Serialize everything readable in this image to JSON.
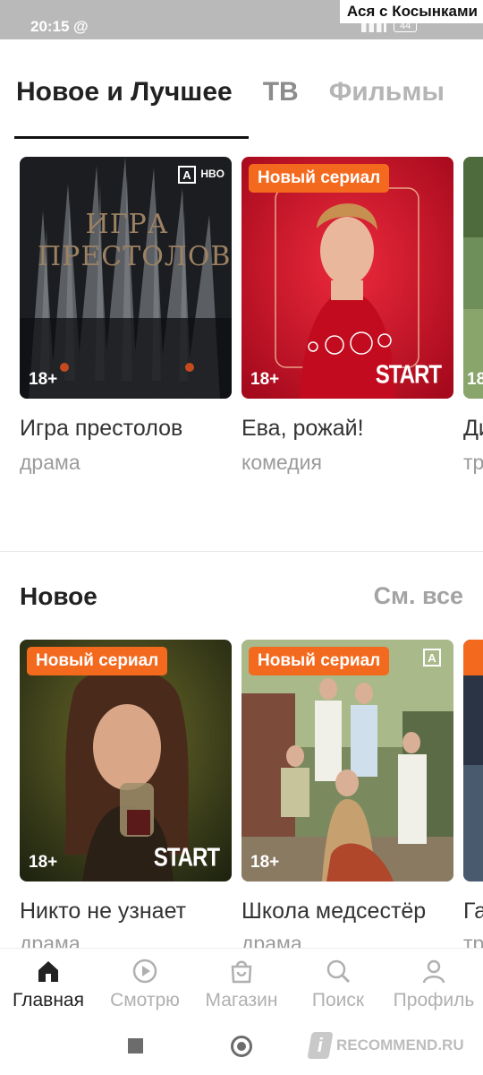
{
  "status_bar": {
    "time": "20:15",
    "at_icon": "@",
    "battery": "44"
  },
  "watermark": "Ася с Косынками",
  "tabs": [
    {
      "label": "Новое и Лучшее",
      "active": true
    },
    {
      "label": "ТВ",
      "active": false
    },
    {
      "label": "Фильмы",
      "active": false
    }
  ],
  "row1": [
    {
      "title": "Игра престолов",
      "genre": "драма",
      "age": "18+",
      "poster_text": "ИГРА ПРЕСТОЛОВ",
      "brand": "HBO"
    },
    {
      "title": "Ева, рожай!",
      "genre": "комедия",
      "age": "18+",
      "badge": "Новый сериал",
      "start": "START"
    },
    {
      "title": "Ди",
      "genre": "тр",
      "age": "18"
    }
  ],
  "section": {
    "title": "Новое",
    "see_all": "См. все"
  },
  "row2": [
    {
      "title": "Никто не узнает",
      "genre": "драма",
      "age": "18+",
      "badge": "Новый сериал",
      "start": "START"
    },
    {
      "title": "Школа медсестёр",
      "genre": "драма",
      "age": "18+",
      "badge": "Новый сериал"
    },
    {
      "title": "Га",
      "genre": "тр"
    }
  ],
  "bottom_nav": [
    {
      "label": "Главная",
      "icon": "home-icon",
      "active": true
    },
    {
      "label": "Смотрю",
      "icon": "play-circle-icon",
      "active": false
    },
    {
      "label": "Магазин",
      "icon": "shopping-bag-icon",
      "active": false
    },
    {
      "label": "Поиск",
      "icon": "search-icon",
      "active": false
    },
    {
      "label": "Профиль",
      "icon": "profile-icon",
      "active": false
    }
  ],
  "recommend_watermark": "RECOMMEND.RU",
  "colors": {
    "accent": "#f36a1f",
    "text": "#222222",
    "muted": "#9b9b9b"
  }
}
